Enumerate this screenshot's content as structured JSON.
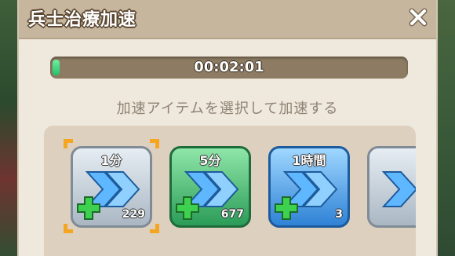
{
  "dialog": {
    "title": "兵士治療加速",
    "timer": "00:02:01",
    "progress_fraction": 0.02,
    "subtitle": "加速アイテムを選択して加速する"
  },
  "items": [
    {
      "label": "1分",
      "count": "229",
      "style": "gray",
      "selected": true
    },
    {
      "label": "5分",
      "count": "677",
      "style": "green",
      "selected": false
    },
    {
      "label": "1時間",
      "count": "3",
      "style": "blue",
      "selected": false
    },
    {
      "label": "",
      "count": "",
      "style": "gray",
      "selected": false
    }
  ],
  "colors": {
    "header": "#c7b69e",
    "dialog_bg": "#efe8dd",
    "progress_fill": "#23c06a",
    "selection_corner": "#f4a623",
    "plus_green": "#3ed14f"
  }
}
